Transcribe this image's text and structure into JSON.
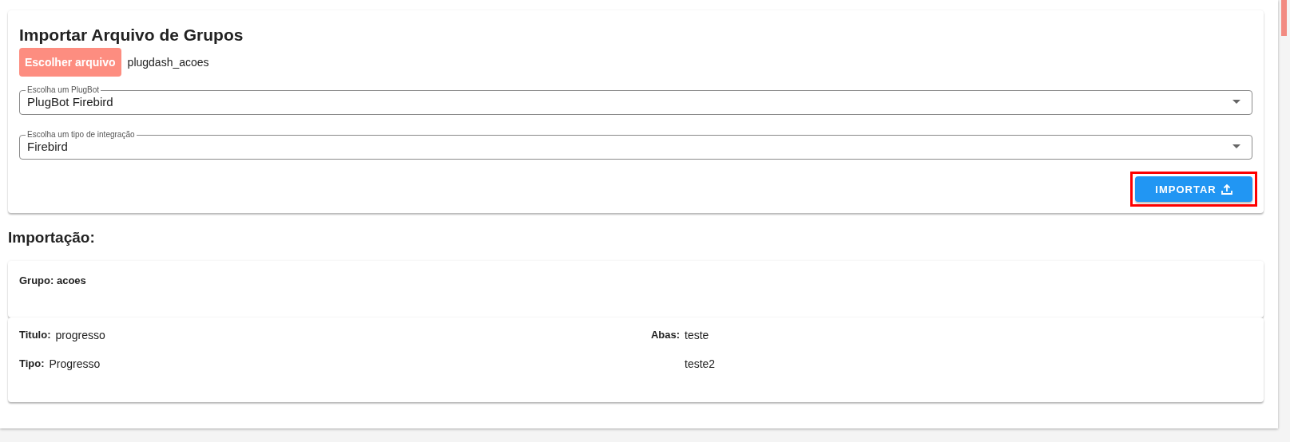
{
  "title": "Importar Arquivo de Grupos",
  "file_button": "Escolher arquivo",
  "file_name": "plugdash_acoes",
  "selects": [
    {
      "label": "Escolha um PlugBot",
      "value": "PlugBot Firebird"
    },
    {
      "label": "Escolha um tipo de integração",
      "value": "Firebird"
    }
  ],
  "import_button": {
    "label": "IMPORTAR",
    "highlighted": true
  },
  "section_title": "Importação:",
  "group": {
    "label": "Grupo:",
    "value": "acoes"
  },
  "details": {
    "fields": [
      {
        "label": "Titulo:",
        "value": "progresso"
      },
      {
        "label": "Tipo:",
        "value": "Progresso"
      }
    ],
    "tabs_label": "Abas:",
    "tabs": [
      "teste",
      "teste2"
    ]
  }
}
